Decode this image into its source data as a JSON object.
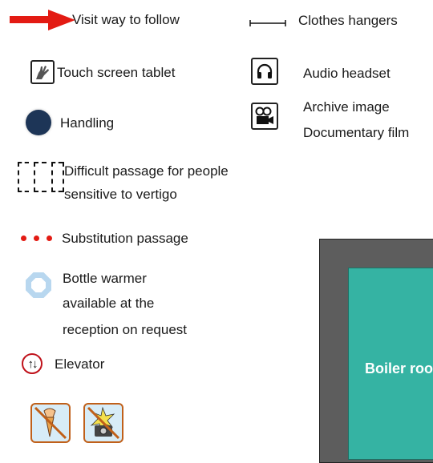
{
  "legend": {
    "visit_way": "Visit way to follow",
    "tablet": "Touch screen tablet",
    "handling": "Handling",
    "vertigo_line1": "Difficult passage for people",
    "vertigo_line2": "sensitive to vertigo",
    "substitution": "Substitution passage",
    "bottle_line1": "Bottle warmer",
    "bottle_line2": "available at the",
    "bottle_line3": "reception on request",
    "elevator": "Elevator",
    "hangers": "Clothes hangers",
    "audio": "Audio headset",
    "archive_line1": "Archive image",
    "archive_line2": "Documentary film"
  },
  "map": {
    "room_label": "Boiler room"
  },
  "colors": {
    "route_red": "#e31b13",
    "handling_navy": "#1d3557",
    "room_teal": "#35b3a3",
    "wall_grey": "#5d5d5d",
    "bottle_blue": "#b8d7ef"
  }
}
